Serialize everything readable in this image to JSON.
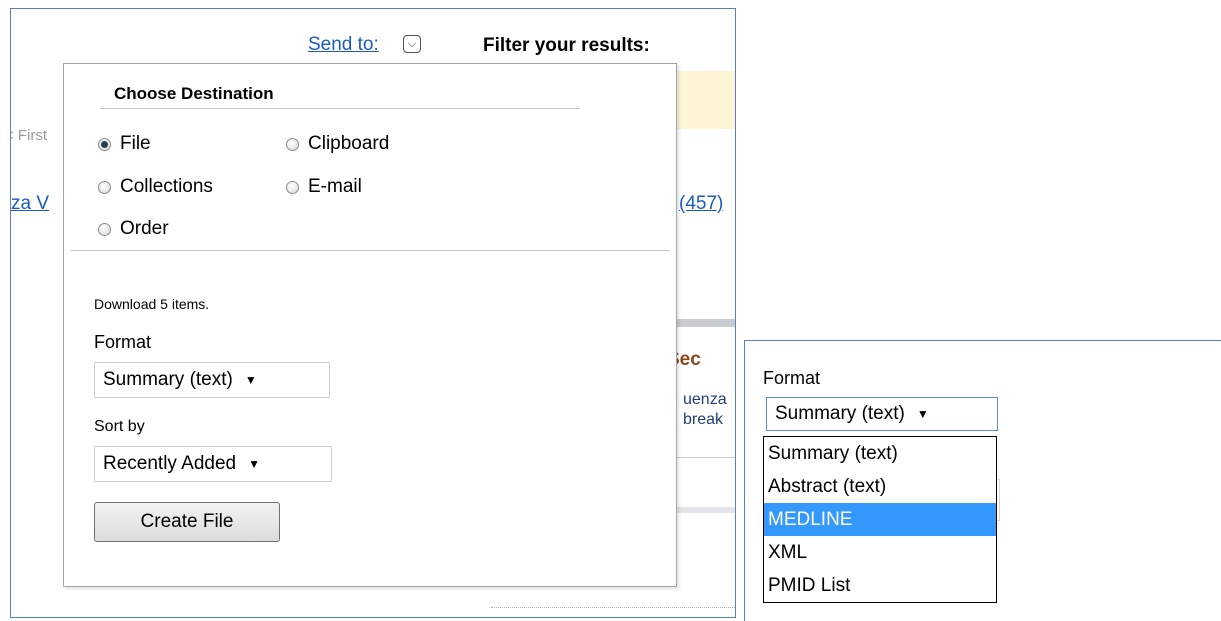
{
  "left_panel": {
    "send_to": "Send to:",
    "filter_label": "Filter your results:",
    "first_link_partial": "< First",
    "left_link_partial": "za V",
    "count_link_partial": "(457)",
    "section_heading_partial": "Sec",
    "snippet_line1_partial": "uenza",
    "snippet_line2_partial": "break"
  },
  "destination_popup": {
    "title": "Choose Destination",
    "options": [
      {
        "label": "File",
        "checked": true
      },
      {
        "label": "Clipboard",
        "checked": false
      },
      {
        "label": "Collections",
        "checked": false
      },
      {
        "label": "E-mail",
        "checked": false
      },
      {
        "label": "Order",
        "checked": false
      }
    ],
    "download_text": "Download 5 items.",
    "format_label": "Format",
    "format_value": "Summary (text)",
    "sort_label": "Sort by",
    "sort_value": "Recently Added",
    "create_button": "Create File"
  },
  "format_inset": {
    "label": "Format",
    "selected_value": "Summary (text)",
    "options": [
      "Summary (text)",
      "Abstract (text)",
      "MEDLINE",
      "XML",
      "PMID List"
    ],
    "highlighted_option": "MEDLINE"
  },
  "colors": {
    "link": "#1c5bbf",
    "highlight": "#3399ff",
    "panel_border": "#5b7fb8",
    "section_heading": "#8a4a1c"
  },
  "icons": {
    "send_to_dropdown": "chevron-down-icon",
    "select_arrow": "dropdown-arrow-icon",
    "radio": "radio-button-icon"
  }
}
